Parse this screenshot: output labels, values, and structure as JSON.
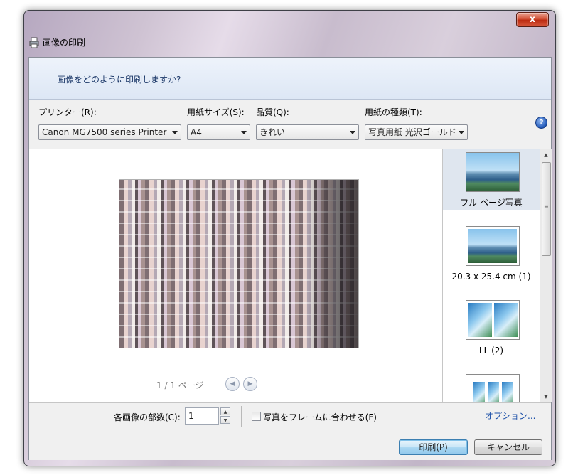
{
  "window": {
    "title": "画像の印刷",
    "close_glyph": "x",
    "instruction": "画像をどのように印刷しますか?"
  },
  "options": {
    "printer_label": "プリンター(R):",
    "printer_value": "Canon MG7500 series Printer",
    "paper_size_label": "用紙サイズ(S):",
    "paper_size_value": "A4",
    "quality_label": "品質(Q):",
    "quality_value": "きれい",
    "paper_type_label": "用紙の種類(T):",
    "paper_type_value": "写真用紙 光沢ゴールド",
    "help_glyph": "?"
  },
  "preview": {
    "page_indicator": "1 / 1 ページ",
    "prev_glyph": "◀",
    "next_glyph": "▶"
  },
  "layouts": [
    {
      "label": "フル ページ写真",
      "selected": true
    },
    {
      "label": "20.3 x 25.4 cm (1)",
      "selected": false
    },
    {
      "label": "LL (2)",
      "selected": false
    },
    {
      "label": "",
      "selected": false
    }
  ],
  "bottom": {
    "copies_label": "各画像の部数(C):",
    "copies_value": "1",
    "fit_checkbox_label": "写真をフレームに合わせる(F)",
    "fit_checked": false,
    "options_link": "オプション..."
  },
  "buttons": {
    "print": "印刷(P)",
    "cancel": "キャンセル"
  }
}
